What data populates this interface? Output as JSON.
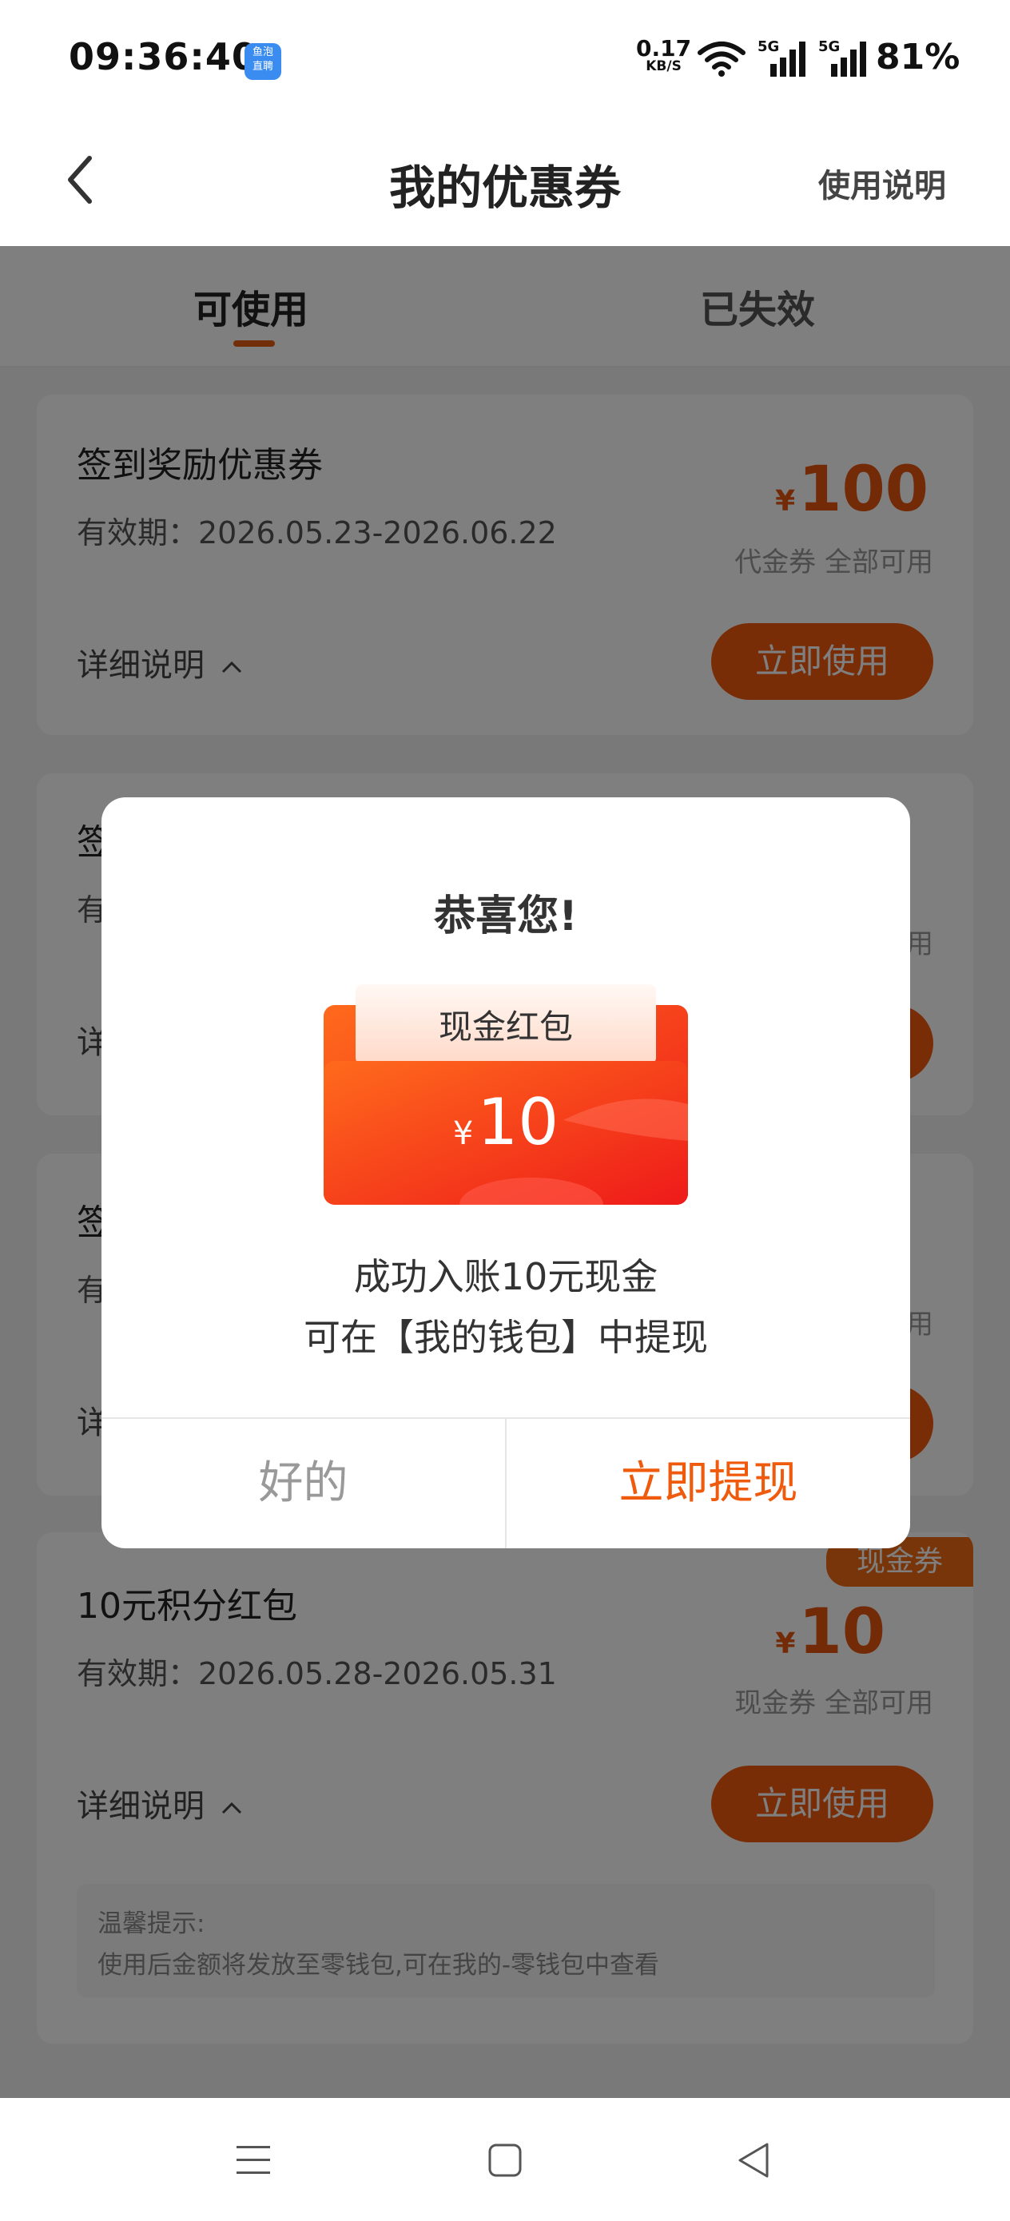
{
  "status_bar": {
    "time": "09:36:40",
    "app_badge_line1": "鱼泡",
    "app_badge_line2": "直聘",
    "net_speed": "0.17",
    "net_speed_unit": "KB/S",
    "signal1_label": "5G",
    "signal2_label": "5G",
    "battery": "81%"
  },
  "nav": {
    "title": "我的优惠券",
    "help": "使用说明"
  },
  "tabs": [
    {
      "label": "可使用",
      "active": true
    },
    {
      "label": "已失效",
      "active": false
    }
  ],
  "coupons": [
    {
      "title": "签到奖励优惠券",
      "valid": "有效期：2026.05.23-2026.06.22",
      "currency": "¥",
      "amount": "100",
      "sub": "代金券 全部可用",
      "detail": "详细说明",
      "button": "立即使用"
    },
    {
      "title": "签",
      "valid": "有",
      "sub": "用",
      "detail": "详"
    },
    {
      "title": "签",
      "valid": "有",
      "sub": "用",
      "detail": "详"
    },
    {
      "tag": "现金券",
      "title": "10元积分红包",
      "valid": "有效期：2026.05.28-2026.05.31",
      "currency": "¥",
      "amount": "10",
      "sub": "现金券 全部可用",
      "detail": "详细说明",
      "button": "立即使用",
      "tip_title": "温馨提示:",
      "tip_text": "使用后金额将发放至零钱包,可在我的-零钱包中查看"
    }
  ],
  "dialog": {
    "title": "恭喜您!",
    "envelope_label": "现金红包",
    "envelope_currency": "¥",
    "envelope_amount": "10",
    "message_line1": "成功入账10元现金",
    "message_line2": "可在【我的钱包】中提现",
    "ok_button": "好的",
    "withdraw_button": "立即提现"
  },
  "colors": {
    "accent": "#ef5a0c",
    "envelope_red": "#f03a1c"
  }
}
